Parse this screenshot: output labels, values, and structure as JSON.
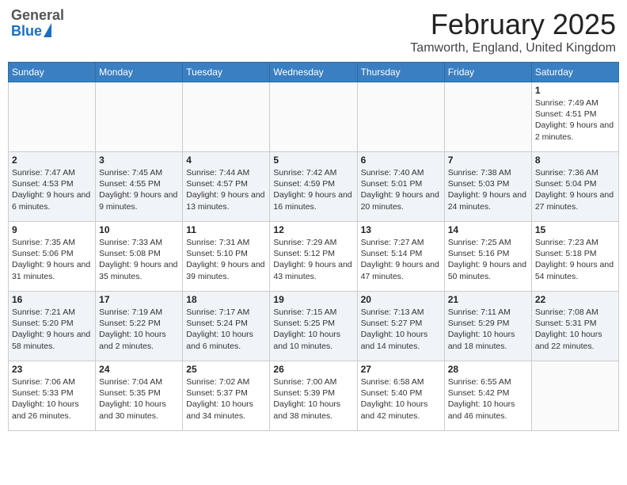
{
  "header": {
    "logo": {
      "line1": "General",
      "line2": "Blue"
    },
    "title": "February 2025",
    "location": "Tamworth, England, United Kingdom"
  },
  "days_of_week": [
    "Sunday",
    "Monday",
    "Tuesday",
    "Wednesday",
    "Thursday",
    "Friday",
    "Saturday"
  ],
  "weeks": [
    [
      {
        "day": "",
        "text": ""
      },
      {
        "day": "",
        "text": ""
      },
      {
        "day": "",
        "text": ""
      },
      {
        "day": "",
        "text": ""
      },
      {
        "day": "",
        "text": ""
      },
      {
        "day": "",
        "text": ""
      },
      {
        "day": "1",
        "text": "Sunrise: 7:49 AM\nSunset: 4:51 PM\nDaylight: 9 hours and 2 minutes."
      }
    ],
    [
      {
        "day": "2",
        "text": "Sunrise: 7:47 AM\nSunset: 4:53 PM\nDaylight: 9 hours and 6 minutes."
      },
      {
        "day": "3",
        "text": "Sunrise: 7:45 AM\nSunset: 4:55 PM\nDaylight: 9 hours and 9 minutes."
      },
      {
        "day": "4",
        "text": "Sunrise: 7:44 AM\nSunset: 4:57 PM\nDaylight: 9 hours and 13 minutes."
      },
      {
        "day": "5",
        "text": "Sunrise: 7:42 AM\nSunset: 4:59 PM\nDaylight: 9 hours and 16 minutes."
      },
      {
        "day": "6",
        "text": "Sunrise: 7:40 AM\nSunset: 5:01 PM\nDaylight: 9 hours and 20 minutes."
      },
      {
        "day": "7",
        "text": "Sunrise: 7:38 AM\nSunset: 5:03 PM\nDaylight: 9 hours and 24 minutes."
      },
      {
        "day": "8",
        "text": "Sunrise: 7:36 AM\nSunset: 5:04 PM\nDaylight: 9 hours and 27 minutes."
      }
    ],
    [
      {
        "day": "9",
        "text": "Sunrise: 7:35 AM\nSunset: 5:06 PM\nDaylight: 9 hours and 31 minutes."
      },
      {
        "day": "10",
        "text": "Sunrise: 7:33 AM\nSunset: 5:08 PM\nDaylight: 9 hours and 35 minutes."
      },
      {
        "day": "11",
        "text": "Sunrise: 7:31 AM\nSunset: 5:10 PM\nDaylight: 9 hours and 39 minutes."
      },
      {
        "day": "12",
        "text": "Sunrise: 7:29 AM\nSunset: 5:12 PM\nDaylight: 9 hours and 43 minutes."
      },
      {
        "day": "13",
        "text": "Sunrise: 7:27 AM\nSunset: 5:14 PM\nDaylight: 9 hours and 47 minutes."
      },
      {
        "day": "14",
        "text": "Sunrise: 7:25 AM\nSunset: 5:16 PM\nDaylight: 9 hours and 50 minutes."
      },
      {
        "day": "15",
        "text": "Sunrise: 7:23 AM\nSunset: 5:18 PM\nDaylight: 9 hours and 54 minutes."
      }
    ],
    [
      {
        "day": "16",
        "text": "Sunrise: 7:21 AM\nSunset: 5:20 PM\nDaylight: 9 hours and 58 minutes."
      },
      {
        "day": "17",
        "text": "Sunrise: 7:19 AM\nSunset: 5:22 PM\nDaylight: 10 hours and 2 minutes."
      },
      {
        "day": "18",
        "text": "Sunrise: 7:17 AM\nSunset: 5:24 PM\nDaylight: 10 hours and 6 minutes."
      },
      {
        "day": "19",
        "text": "Sunrise: 7:15 AM\nSunset: 5:25 PM\nDaylight: 10 hours and 10 minutes."
      },
      {
        "day": "20",
        "text": "Sunrise: 7:13 AM\nSunset: 5:27 PM\nDaylight: 10 hours and 14 minutes."
      },
      {
        "day": "21",
        "text": "Sunrise: 7:11 AM\nSunset: 5:29 PM\nDaylight: 10 hours and 18 minutes."
      },
      {
        "day": "22",
        "text": "Sunrise: 7:08 AM\nSunset: 5:31 PM\nDaylight: 10 hours and 22 minutes."
      }
    ],
    [
      {
        "day": "23",
        "text": "Sunrise: 7:06 AM\nSunset: 5:33 PM\nDaylight: 10 hours and 26 minutes."
      },
      {
        "day": "24",
        "text": "Sunrise: 7:04 AM\nSunset: 5:35 PM\nDaylight: 10 hours and 30 minutes."
      },
      {
        "day": "25",
        "text": "Sunrise: 7:02 AM\nSunset: 5:37 PM\nDaylight: 10 hours and 34 minutes."
      },
      {
        "day": "26",
        "text": "Sunrise: 7:00 AM\nSunset: 5:39 PM\nDaylight: 10 hours and 38 minutes."
      },
      {
        "day": "27",
        "text": "Sunrise: 6:58 AM\nSunset: 5:40 PM\nDaylight: 10 hours and 42 minutes."
      },
      {
        "day": "28",
        "text": "Sunrise: 6:55 AM\nSunset: 5:42 PM\nDaylight: 10 hours and 46 minutes."
      },
      {
        "day": "",
        "text": ""
      }
    ]
  ]
}
